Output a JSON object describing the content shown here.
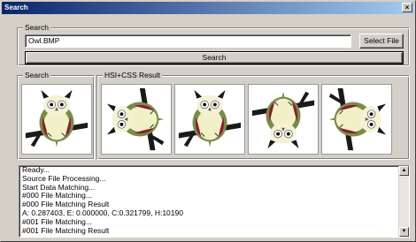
{
  "window": {
    "title": "Search",
    "close_glyph": "×"
  },
  "search_group": {
    "label": "Search",
    "file_value": "Owl.BMP",
    "select_button": "Select File",
    "search_button": "Search"
  },
  "query_group": {
    "label": "Search"
  },
  "results_group": {
    "label": "HSI+CSS Result"
  },
  "images": {
    "query": {
      "icon": "owl-image",
      "rotation_deg": 0
    },
    "results": [
      {
        "icon": "owl-image",
        "rotation_deg": -90
      },
      {
        "icon": "owl-image",
        "rotation_deg": 0
      },
      {
        "icon": "owl-image",
        "rotation_deg": 180
      },
      {
        "icon": "owl-image",
        "rotation_deg": 90
      }
    ]
  },
  "log": {
    "lines": [
      "Ready...",
      "Source File Processing...",
      "Start Data Matching...",
      "#000 File Matching...",
      "#000 File Matching Result",
      "A: 0.287403, E: 0.000000, C:0.321799, H:10190",
      "#001 File Matching...",
      "#001 File Matching Result"
    ],
    "scroll_up_glyph": "▲",
    "scroll_down_glyph": "▼"
  }
}
